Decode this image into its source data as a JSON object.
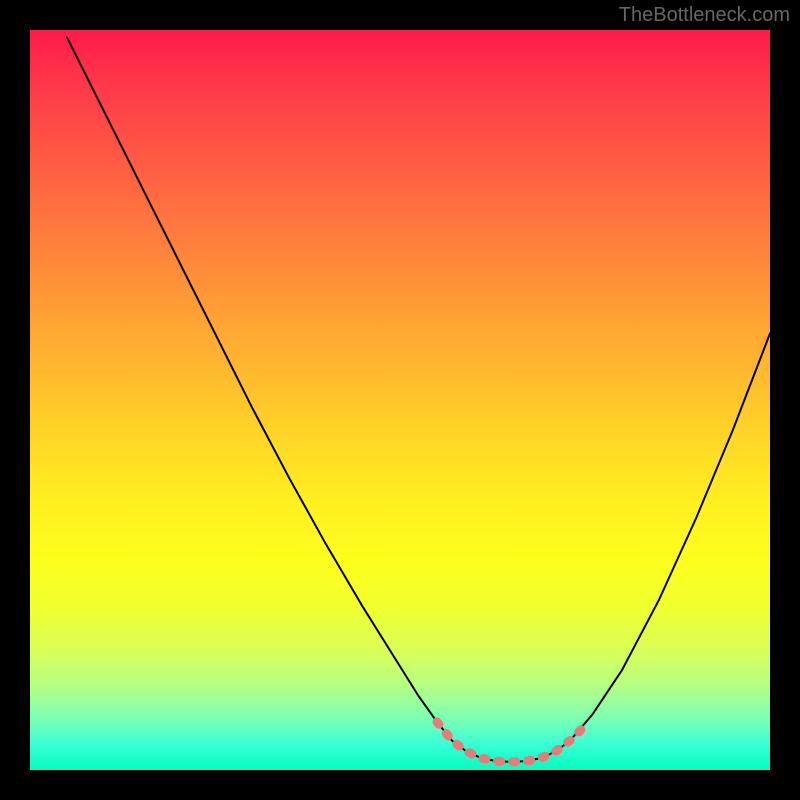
{
  "watermark": "TheBottleneck.com",
  "chart_data": {
    "type": "line",
    "title": "",
    "xlabel": "",
    "ylabel": "",
    "xlim": [
      0,
      100
    ],
    "ylim": [
      0,
      100
    ],
    "series": [
      {
        "name": "black-curve",
        "color": "#000000",
        "points": [
          {
            "x": 5.0,
            "y": 99.0
          },
          {
            "x": 10.0,
            "y": 89.0
          },
          {
            "x": 15.0,
            "y": 79.0
          },
          {
            "x": 20.0,
            "y": 69.0
          },
          {
            "x": 25.0,
            "y": 59.0
          },
          {
            "x": 30.0,
            "y": 49.0
          },
          {
            "x": 35.0,
            "y": 39.5
          },
          {
            "x": 40.0,
            "y": 30.5
          },
          {
            "x": 45.0,
            "y": 22.0
          },
          {
            "x": 50.0,
            "y": 14.0
          },
          {
            "x": 52.5,
            "y": 10.0
          },
          {
            "x": 55.0,
            "y": 6.5
          },
          {
            "x": 57.0,
            "y": 4.0
          },
          {
            "x": 59.0,
            "y": 2.5
          },
          {
            "x": 61.0,
            "y": 1.6
          },
          {
            "x": 63.0,
            "y": 1.2
          },
          {
            "x": 65.0,
            "y": 1.1
          },
          {
            "x": 67.0,
            "y": 1.2
          },
          {
            "x": 69.0,
            "y": 1.6
          },
          {
            "x": 71.0,
            "y": 2.5
          },
          {
            "x": 73.0,
            "y": 4.0
          },
          {
            "x": 76.0,
            "y": 7.5
          },
          {
            "x": 80.0,
            "y": 13.5
          },
          {
            "x": 85.0,
            "y": 23.0
          },
          {
            "x": 90.0,
            "y": 34.0
          },
          {
            "x": 95.0,
            "y": 46.0
          },
          {
            "x": 100.0,
            "y": 59.0
          }
        ]
      },
      {
        "name": "red-highlight-dotted",
        "color": "#e97a7a",
        "points": [
          {
            "x": 55.0,
            "y": 6.5
          },
          {
            "x": 57.0,
            "y": 4.0
          },
          {
            "x": 59.0,
            "y": 2.5
          },
          {
            "x": 61.0,
            "y": 1.6
          },
          {
            "x": 63.0,
            "y": 1.2
          },
          {
            "x": 65.0,
            "y": 1.1
          },
          {
            "x": 67.0,
            "y": 1.2
          },
          {
            "x": 69.0,
            "y": 1.6
          },
          {
            "x": 71.0,
            "y": 2.5
          },
          {
            "x": 73.0,
            "y": 4.0
          },
          {
            "x": 74.5,
            "y": 5.5
          }
        ]
      }
    ]
  }
}
